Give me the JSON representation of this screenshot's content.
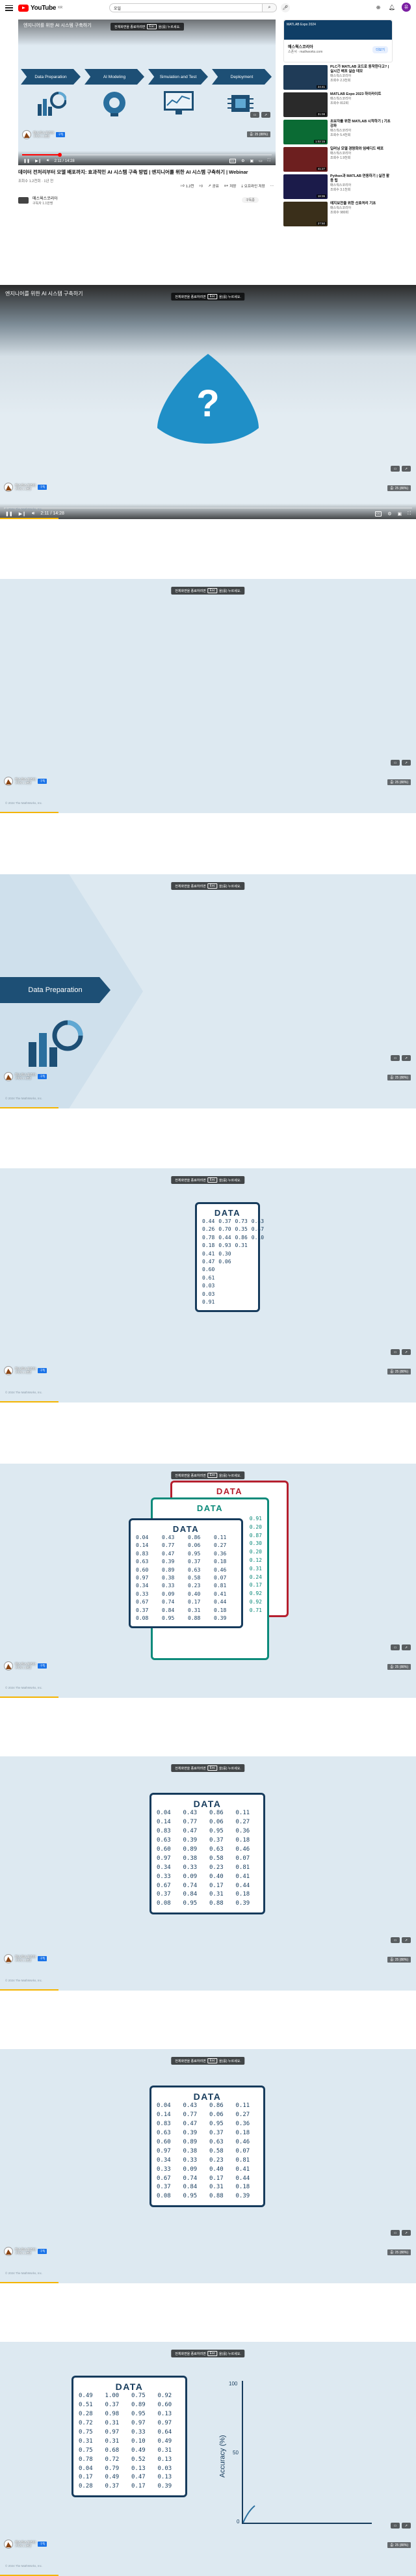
{
  "topbar": {
    "logo_text": "YouTube",
    "region": "KR",
    "search_value": "오일",
    "search_icon": "search-icon",
    "avatar_letter": "유"
  },
  "player": {
    "hint_prefix": "전체화면을 종료하려면",
    "hint_key": "Esc",
    "hint_suffix": "을(를) 누르세요.",
    "overlay_title": "엔지니어를 위한 AI 시스템 구축하기",
    "stages": [
      "Data Preparation",
      "AI Modeling",
      "Simulation and Test",
      "Deployment"
    ],
    "time": "2:11 / 14:28",
    "progress": 0.15,
    "zoom": "줌: 25 (88%)"
  },
  "video": {
    "title": "데이터 전처리부터 모델 배포까지: 효과적인 AI 시스템 구축 방법 | 엔지니어를 위한 AI 시스템 구축하기 | Webinar",
    "meta": "조회수 1.2천회 · 1년 전",
    "like_count": "1.2천",
    "actions": [
      "공유",
      "저장",
      "오프라인 저장",
      "⋯"
    ],
    "channel_name": "매스웍스코리아",
    "channel_subs": "구독자 1.1만명",
    "subscribe_label": "구독중"
  },
  "sidebar": {
    "ad": {
      "banner_text": "MATLAB Expo 2024",
      "name": "매스웍스코리아",
      "sub": "스폰서 · mathworks.com",
      "cta": "더보기"
    },
    "recs": [
      {
        "title": "PLC가 MATLAB 코드로 동작한다고? | 실시간 배포 실습 데모",
        "channel": "매스웍스코리아",
        "views": "조회수 2.3천회",
        "duration": "24:41",
        "color": "#1f3b57"
      },
      {
        "title": "MATLAB Expo 2023 하이라이트",
        "channel": "매스웍스코리아",
        "views": "조회수 812회",
        "duration": "31:08",
        "color": "#2a2a2a"
      },
      {
        "title": "초보자를 위한 MATLAB 시작하기 | 기초 강좌",
        "channel": "매스웍스코리아",
        "views": "조회수 5.4천회",
        "duration": "1:02:15",
        "color": "#0b6b34"
      },
      {
        "title": "딥러닝 모델 경량화와 임베디드 배포",
        "channel": "매스웍스코리아",
        "views": "조회수 1.9천회",
        "duration": "41:27",
        "color": "#6d1f1f"
      },
      {
        "title": "Python과 MATLAB 연동하기 | 실전 활용 팁",
        "channel": "매스웍스코리아",
        "views": "조회수 3.1천회",
        "duration": "18:36",
        "color": "#1b1b4a"
      },
      {
        "title": "예지보전을 위한 신호처리 기초",
        "channel": "매스웍스코리아",
        "views": "조회수 980회",
        "duration": "27:50",
        "color": "#3a2f1a"
      }
    ]
  },
  "frames": {
    "title": "엔지니어를 위한 AI 시스템 구축하기",
    "hint_prefix": "전체화면을 종료하려면",
    "hint_key": "Esc",
    "hint_suffix": "을(를) 누르세요.",
    "zoom": "줌: 25 (88%)",
    "channel_name": "매스웍스코리아",
    "channel_sub": "구독자 1.1만명",
    "subscribe": "구독",
    "caption": "© 2024 The MathWorks, Inc.",
    "data_prep_label": "Data Preparation",
    "data_label": "DATA",
    "accuracy_label": "Accuracy (%)",
    "acc_ticks": [
      "100",
      "50",
      "0"
    ]
  },
  "data_tables": {
    "frame4": [
      "0.44",
      "0.37",
      "0.73",
      "0.43",
      "0.26",
      "0.70",
      "0.35",
      "0.47",
      "0.78",
      "0.44",
      "0.86",
      "0.10",
      "0.18",
      "0.93",
      "0.31",
      "",
      "0.41",
      "0.30",
      "",
      "",
      "0.47",
      "0.06",
      "",
      "",
      "0.60",
      "",
      "",
      "",
      "0.61",
      "",
      "",
      "",
      "0.03",
      "",
      "",
      "",
      "0.03",
      "",
      "",
      "",
      "0.91",
      "",
      "",
      ""
    ],
    "frame5_back": [
      "0.91",
      "0.20",
      "0.87",
      "0.30",
      "0.20",
      "0.12",
      "0.31",
      "0.24",
      "0.17",
      "0.92",
      "0.92",
      "0.71"
    ],
    "frame5_front": [
      "0.04",
      "0.43",
      "0.86",
      "0.11",
      "0.14",
      "0.77",
      "0.06",
      "0.27",
      "0.83",
      "0.47",
      "0.95",
      "0.36",
      "0.63",
      "0.39",
      "0.37",
      "0.18",
      "0.60",
      "0.89",
      "0.63",
      "0.46",
      "0.97",
      "0.38",
      "0.58",
      "0.07",
      "0.34",
      "0.33",
      "0.23",
      "0.81",
      "0.33",
      "0.09",
      "0.40",
      "0.41",
      "0.67",
      "0.74",
      "0.17",
      "0.44",
      "0.37",
      "0.84",
      "0.31",
      "0.18",
      "0.08",
      "0.95",
      "0.88",
      "0.39"
    ],
    "frame6": [
      "0.04",
      "0.43",
      "0.86",
      "0.11",
      "0.14",
      "0.77",
      "0.06",
      "0.27",
      "0.83",
      "0.47",
      "0.95",
      "0.36",
      "0.63",
      "0.39",
      "0.37",
      "0.18",
      "0.60",
      "0.89",
      "0.63",
      "0.46",
      "0.97",
      "0.38",
      "0.58",
      "0.07",
      "0.34",
      "0.33",
      "0.23",
      "0.81",
      "0.33",
      "0.09",
      "0.40",
      "0.41",
      "0.67",
      "0.74",
      "0.17",
      "0.44",
      "0.37",
      "0.84",
      "0.31",
      "0.18",
      "0.08",
      "0.95",
      "0.88",
      "0.39"
    ],
    "frame7": [
      "0.04",
      "0.43",
      "0.86",
      "0.11",
      "0.14",
      "0.77",
      "0.06",
      "0.27",
      "0.83",
      "0.47",
      "0.95",
      "0.36",
      "0.63",
      "0.39",
      "0.37",
      "0.18",
      "0.60",
      "0.89",
      "0.63",
      "0.46",
      "0.97",
      "0.38",
      "0.58",
      "0.07",
      "0.34",
      "0.33",
      "0.23",
      "0.81",
      "0.33",
      "0.09",
      "0.40",
      "0.41",
      "0.67",
      "0.74",
      "0.17",
      "0.44",
      "0.37",
      "0.84",
      "0.31",
      "0.18",
      "0.08",
      "0.95",
      "0.88",
      "0.39"
    ],
    "frame8": [
      "0.49",
      "1.00",
      "0.75",
      "0.92",
      "0.51",
      "0.37",
      "0.89",
      "0.60",
      "0.28",
      "0.98",
      "0.95",
      "0.13",
      "0.72",
      "0.31",
      "0.97",
      "0.97",
      "0.75",
      "0.97",
      "0.33",
      "0.64",
      "0.31",
      "0.31",
      "0.10",
      "0.49",
      "0.75",
      "0.68",
      "0.49",
      "0.31",
      "0.78",
      "0.72",
      "0.52",
      "0.13",
      "0.04",
      "0.79",
      "0.13",
      "0.03",
      "0.17",
      "0.49",
      "0.47",
      "0.13",
      "0.28",
      "0.37",
      "0.17",
      "0.39"
    ]
  }
}
